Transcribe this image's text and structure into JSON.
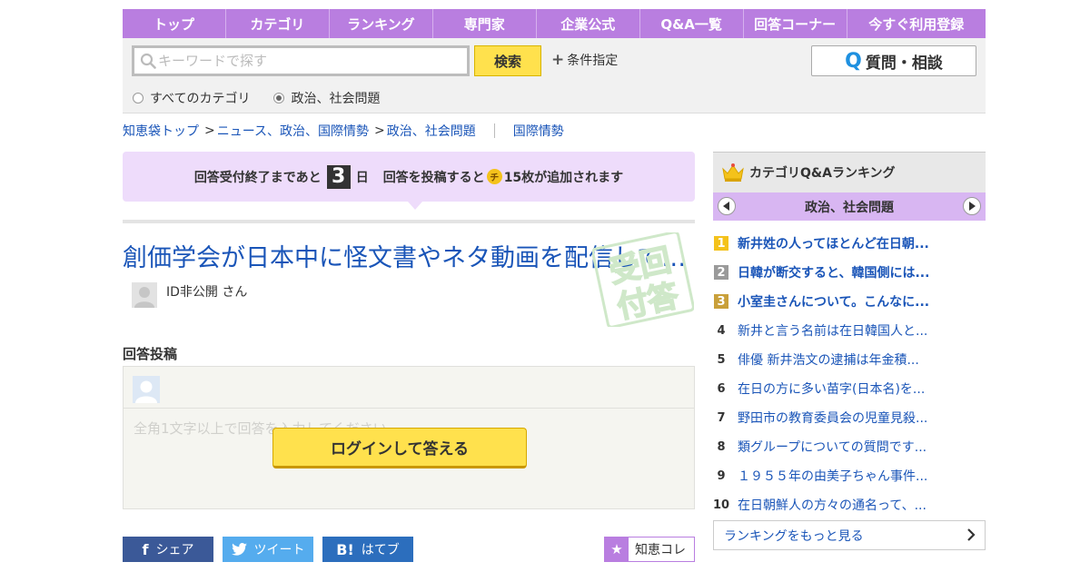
{
  "nav": [
    "トップ",
    "カテゴリ",
    "ランキング",
    "専門家",
    "企業公式",
    "Q&A一覧",
    "回答コーナー",
    "今すぐ利用登録"
  ],
  "search": {
    "placeholder": "キーワードで探す",
    "button": "検索",
    "condition": "条件指定",
    "ask_button": "質問・相談",
    "radio_all": "すべてのカテゴリ",
    "radio_current": "政治、社会問題"
  },
  "breadcrumb": {
    "top": "知恵袋トップ",
    "sep1": ">",
    "cat1": "ニュース、政治、国際情勢",
    "sep2": ">",
    "cat2": "政治、社会問題",
    "related": "国際情勢"
  },
  "notice": {
    "prefix": "回答受付終了まであと",
    "days": "3",
    "day_unit": "日",
    "mid": "回答を投稿すると",
    "coin": "チ",
    "suffix": "15枚が追加されます"
  },
  "question": {
    "title": "創価学会が日本中に怪文書やネタ動画を配信していますか？",
    "stamp_top": "受回",
    "stamp_bottom": "付答",
    "asker": "ID非公開 さん"
  },
  "answer": {
    "label": "回答投稿",
    "placeholder": "全角1文字以上で回答を入力してください",
    "login_button": "ログインして答える"
  },
  "share": {
    "fb_icon": "f",
    "fb": "シェア",
    "tw": "ツイート",
    "hb_icon": "B!",
    "hb": "はてブ",
    "chiekore": "知恵コレ"
  },
  "ranking": {
    "title": "カテゴリQ&Aランキング",
    "category": "政治、社会問題",
    "items": [
      {
        "rank": "1",
        "text": "新井姓の人ってほとんど在日朝..."
      },
      {
        "rank": "2",
        "text": "日韓が断交すると、韓国側には..."
      },
      {
        "rank": "3",
        "text": "小室圭さんについて。こんなに..."
      },
      {
        "rank": "4",
        "text": "新井と言う名前は在日韓国人と..."
      },
      {
        "rank": "5",
        "text": "俳優 新井浩文の逮捕は年金積..."
      },
      {
        "rank": "6",
        "text": "在日の方に多い苗字(日本名)を..."
      },
      {
        "rank": "7",
        "text": "野田市の教育委員会の児童見殺..."
      },
      {
        "rank": "8",
        "text": "類グループについての質問です..."
      },
      {
        "rank": "9",
        "text": "１９５５年の由美子ちゃん事件..."
      },
      {
        "rank": "10",
        "text": "在日朝鮮人の方々の通名って、..."
      }
    ],
    "more": "ランキングをもっと見る"
  },
  "colors": {
    "accent_purple": "#b97ee0",
    "link_blue": "#1a55b8",
    "button_yellow": "#ffe14d",
    "facebook": "#3b5998",
    "twitter": "#55acee",
    "hatena": "#2c6ebd"
  }
}
